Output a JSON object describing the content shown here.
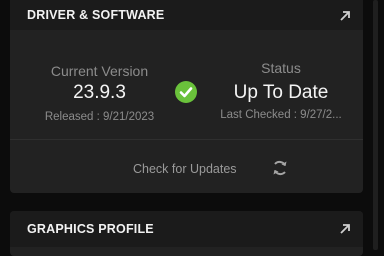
{
  "driver_card": {
    "title": "DRIVER & SOFTWARE",
    "expand_icon": "expand-arrow-icon",
    "current_version": {
      "label": "Current Version",
      "value": "23.9.3",
      "released": "Released : 9/21/2023"
    },
    "status_icon": "check-circle-icon",
    "status": {
      "label": "Status",
      "value": "Up To Date",
      "last_checked": "Last Checked : 9/27/2..."
    },
    "check_updates_label": "Check for Updates",
    "refresh_icon": "refresh-icon"
  },
  "graphics_card": {
    "title": "GRAPHICS PROFILE",
    "expand_icon": "expand-arrow-icon"
  },
  "colors": {
    "background": "#0c0c0c",
    "card": "#222222",
    "header": "#1b1b1b",
    "success": "#6ac23b",
    "text_primary": "#f4f4f4",
    "text_secondary": "#8c8c8c"
  }
}
